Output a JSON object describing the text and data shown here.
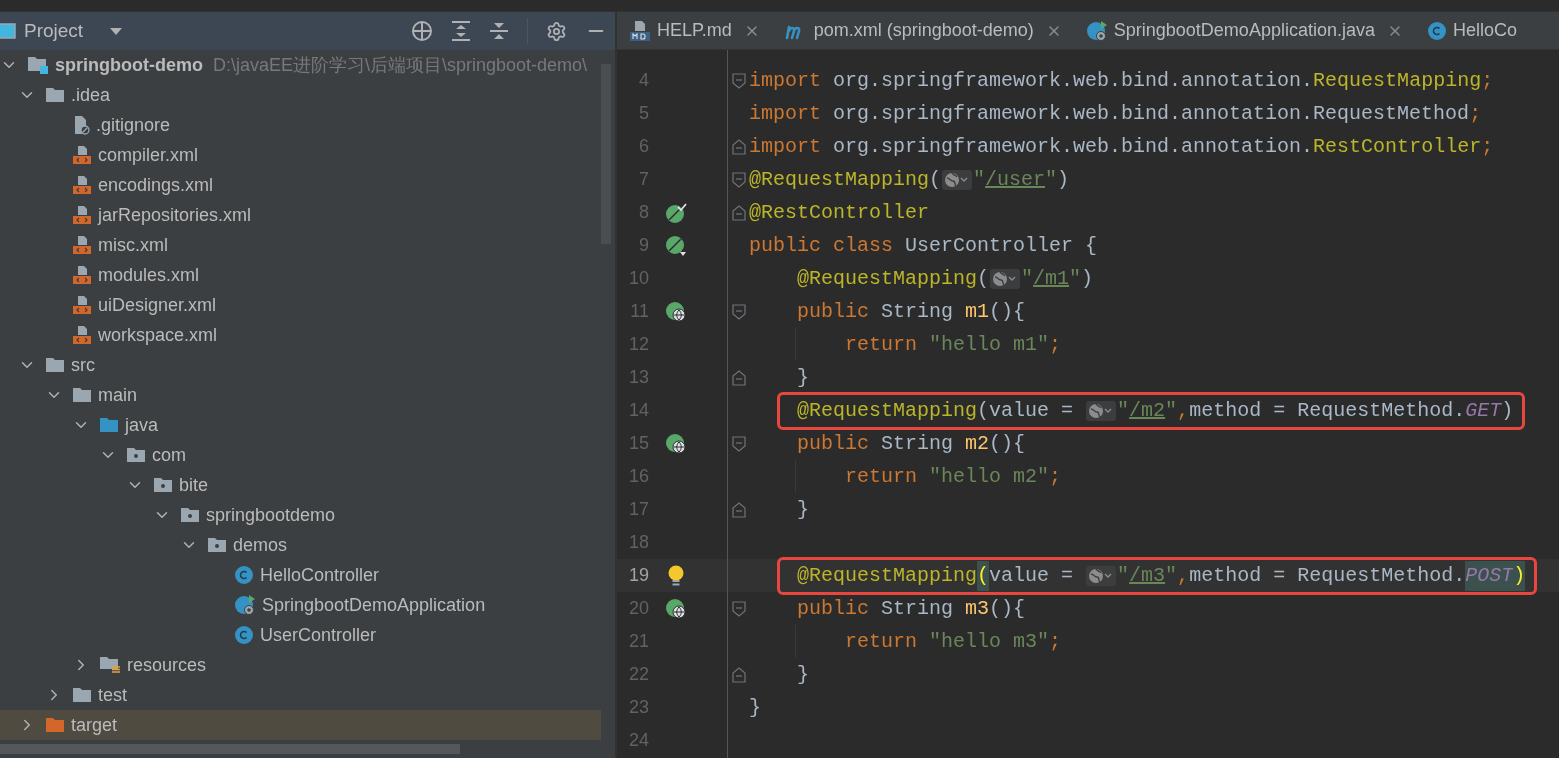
{
  "project_panel": {
    "title": "Project",
    "tree": [
      {
        "kind": "module",
        "name": "springboot-demo",
        "path": "D:\\javaEE进阶学习\\后端项目\\springboot-demo\\",
        "expanded": true,
        "children": [
          {
            "kind": "folder",
            "name": ".idea",
            "expanded": true,
            "children": [
              {
                "kind": "ignore-file",
                "name": ".gitignore"
              },
              {
                "kind": "xml-file",
                "name": "compiler.xml"
              },
              {
                "kind": "xml-file",
                "name": "encodings.xml"
              },
              {
                "kind": "xml-file",
                "name": "jarRepositories.xml"
              },
              {
                "kind": "xml-file",
                "name": "misc.xml"
              },
              {
                "kind": "xml-file",
                "name": "modules.xml"
              },
              {
                "kind": "xml-file",
                "name": "uiDesigner.xml"
              },
              {
                "kind": "xml-file",
                "name": "workspace.xml"
              }
            ]
          },
          {
            "kind": "folder",
            "name": "src",
            "expanded": true,
            "children": [
              {
                "kind": "folder",
                "name": "main",
                "expanded": true,
                "children": [
                  {
                    "kind": "source-folder",
                    "name": "java",
                    "expanded": true,
                    "children": [
                      {
                        "kind": "package",
                        "name": "com",
                        "expanded": true,
                        "children": [
                          {
                            "kind": "package",
                            "name": "bite",
                            "expanded": true,
                            "children": [
                              {
                                "kind": "package",
                                "name": "springbootdemo",
                                "expanded": true,
                                "children": [
                                  {
                                    "kind": "package",
                                    "name": "demos",
                                    "expanded": true,
                                    "children": [
                                      {
                                        "kind": "class",
                                        "name": "HelloController"
                                      },
                                      {
                                        "kind": "app-class",
                                        "name": "SpringbootDemoApplication"
                                      },
                                      {
                                        "kind": "class",
                                        "name": "UserController"
                                      }
                                    ]
                                  }
                                ]
                              }
                            ]
                          }
                        ]
                      }
                    ]
                  },
                  {
                    "kind": "resources-folder",
                    "name": "resources",
                    "expanded": false
                  }
                ]
              },
              {
                "kind": "folder",
                "name": "test",
                "expanded": false
              }
            ]
          },
          {
            "kind": "excluded-folder",
            "name": "target",
            "expanded": false
          }
        ]
      }
    ]
  },
  "editor": {
    "tabs": [
      {
        "kind": "md",
        "label": "HELP.md",
        "selected": false,
        "closable": true
      },
      {
        "kind": "maven",
        "label": "pom.xml (springboot-demo)",
        "selected": false,
        "closable": true
      },
      {
        "kind": "spring-app",
        "label": "SpringbootDemoApplication.java",
        "selected": false,
        "closable": true
      },
      {
        "kind": "class",
        "label": "HelloCo",
        "selected": false,
        "closable": false
      }
    ],
    "lines": [
      {
        "number": "4",
        "fold": {
          "kind": "start"
        },
        "current": false,
        "highlighted": false,
        "tokens": [
          {
            "kind": "keyword",
            "text": "import"
          },
          {
            "kind": "plain",
            "text": " org.springframework.web.bind.annotation."
          },
          {
            "kind": "annotation",
            "text": "RequestMapping"
          },
          {
            "kind": "keyword",
            "text": ";"
          }
        ]
      },
      {
        "number": "5",
        "current": false,
        "highlighted": false,
        "tokens": [
          {
            "kind": "keyword",
            "text": "import"
          },
          {
            "kind": "plain",
            "text": " org.springframework.web.bind.annotation.RequestMethod"
          },
          {
            "kind": "keyword",
            "text": ";"
          }
        ]
      },
      {
        "number": "6",
        "fold": {
          "kind": "end"
        },
        "current": false,
        "highlighted": false,
        "tokens": [
          {
            "kind": "keyword",
            "text": "import"
          },
          {
            "kind": "plain",
            "text": " org.springframework.web.bind.annotation."
          },
          {
            "kind": "annotation",
            "text": "RestController"
          },
          {
            "kind": "keyword",
            "text": ";"
          }
        ]
      },
      {
        "number": "7",
        "fold": {
          "kind": "start"
        },
        "current": false,
        "highlighted": false,
        "tokens": [
          {
            "kind": "annotation",
            "text": "@RequestMapping"
          },
          {
            "kind": "plain",
            "text": "("
          },
          {
            "kind": "inlay"
          },
          {
            "kind": "string",
            "text": "\""
          },
          {
            "kind": "link",
            "text": "/user"
          },
          {
            "kind": "string",
            "text": "\""
          },
          {
            "kind": "plain",
            "text": ")"
          }
        ]
      },
      {
        "number": "8",
        "gutter": {
          "kind": "bean-check"
        },
        "fold": {
          "kind": "end"
        },
        "current": false,
        "highlighted": false,
        "tokens": [
          {
            "kind": "annotation",
            "text": "@RestController"
          }
        ]
      },
      {
        "number": "9",
        "gutter": {
          "kind": "bean-down"
        },
        "current": false,
        "highlighted": false,
        "tokens": [
          {
            "kind": "keyword",
            "text": "public class "
          },
          {
            "kind": "plain",
            "text": "UserController {"
          }
        ]
      },
      {
        "number": "10",
        "indent": {
          "kind": "single"
        },
        "current": false,
        "highlighted": false,
        "tokens": [
          {
            "kind": "annotation",
            "text": "@RequestMapping"
          },
          {
            "kind": "plain",
            "text": "("
          },
          {
            "kind": "inlay"
          },
          {
            "kind": "string",
            "text": "\""
          },
          {
            "kind": "link",
            "text": "/m1"
          },
          {
            "kind": "string",
            "text": "\""
          },
          {
            "kind": "plain",
            "text": ")"
          }
        ]
      },
      {
        "number": "11",
        "indent": {
          "kind": "single"
        },
        "gutter": {
          "kind": "web"
        },
        "fold": {
          "kind": "start"
        },
        "current": false,
        "highlighted": false,
        "tokens": [
          {
            "kind": "keyword",
            "text": "public "
          },
          {
            "kind": "plain",
            "text": "String "
          },
          {
            "kind": "method",
            "text": "m1"
          },
          {
            "kind": "plain",
            "text": "(){"
          }
        ]
      },
      {
        "number": "12",
        "indent": {
          "kind": "double"
        },
        "current": false,
        "highlighted": false,
        "tokens": [
          {
            "kind": "keyword",
            "text": "return "
          },
          {
            "kind": "string",
            "text": "\"hello m1\""
          },
          {
            "kind": "keyword",
            "text": ";"
          }
        ]
      },
      {
        "number": "13",
        "indent": {
          "kind": "single"
        },
        "fold": {
          "kind": "end"
        },
        "current": false,
        "highlighted": false,
        "tokens": [
          {
            "kind": "plain",
            "text": "}"
          }
        ]
      },
      {
        "number": "14",
        "indent": {
          "kind": "single"
        },
        "current": false,
        "highlighted": true,
        "tokens": [
          {
            "kind": "annotation",
            "text": "@RequestMapping"
          },
          {
            "kind": "plain",
            "text": "(value = "
          },
          {
            "kind": "inlay"
          },
          {
            "kind": "string",
            "text": "\""
          },
          {
            "kind": "link",
            "text": "/m2"
          },
          {
            "kind": "string",
            "text": "\""
          },
          {
            "kind": "keyword",
            "text": ","
          },
          {
            "kind": "plain",
            "text": "method = RequestMethod."
          },
          {
            "kind": "constant",
            "text": "GET"
          },
          {
            "kind": "plain",
            "text": ")"
          }
        ]
      },
      {
        "number": "15",
        "indent": {
          "kind": "single"
        },
        "gutter": {
          "kind": "web"
        },
        "fold": {
          "kind": "start"
        },
        "current": false,
        "highlighted": false,
        "tokens": [
          {
            "kind": "keyword",
            "text": "public "
          },
          {
            "kind": "plain",
            "text": "String "
          },
          {
            "kind": "method",
            "text": "m2"
          },
          {
            "kind": "plain",
            "text": "(){"
          }
        ]
      },
      {
        "number": "16",
        "indent": {
          "kind": "double"
        },
        "current": false,
        "highlighted": false,
        "tokens": [
          {
            "kind": "keyword",
            "text": "return "
          },
          {
            "kind": "string",
            "text": "\"hello m2\""
          },
          {
            "kind": "keyword",
            "text": ";"
          }
        ]
      },
      {
        "number": "17",
        "indent": {
          "kind": "single"
        },
        "fold": {
          "kind": "end"
        },
        "current": false,
        "highlighted": false,
        "tokens": [
          {
            "kind": "plain",
            "text": "}"
          }
        ]
      },
      {
        "number": "18",
        "current": false,
        "highlighted": false
      },
      {
        "number": "19",
        "indent": {
          "kind": "single"
        },
        "gutter": {
          "kind": "bulb"
        },
        "current": true,
        "highlighted": true,
        "tokens": [
          {
            "kind": "annotation",
            "text": "@RequestMapping"
          },
          {
            "kind": "brace-match",
            "text": "("
          },
          {
            "kind": "plain",
            "text": "value = "
          },
          {
            "kind": "inlay"
          },
          {
            "kind": "string",
            "text": "\""
          },
          {
            "kind": "link",
            "text": "/m3"
          },
          {
            "kind": "string",
            "text": "\""
          },
          {
            "kind": "keyword",
            "text": ","
          },
          {
            "kind": "plain",
            "text": "method = RequestMethod."
          },
          {
            "kind": "constant-match",
            "text": "POST"
          },
          {
            "kind": "brace-match",
            "text": ")"
          }
        ]
      },
      {
        "number": "20",
        "indent": {
          "kind": "single"
        },
        "gutter": {
          "kind": "web"
        },
        "fold": {
          "kind": "start"
        },
        "current": false,
        "highlighted": false,
        "tokens": [
          {
            "kind": "keyword",
            "text": "public "
          },
          {
            "kind": "plain",
            "text": "String "
          },
          {
            "kind": "method",
            "text": "m3"
          },
          {
            "kind": "plain",
            "text": "(){"
          }
        ]
      },
      {
        "number": "21",
        "indent": {
          "kind": "double"
        },
        "current": false,
        "highlighted": false,
        "tokens": [
          {
            "kind": "keyword",
            "text": "return "
          },
          {
            "kind": "string",
            "text": "\"hello m3\""
          },
          {
            "kind": "keyword",
            "text": ";"
          }
        ]
      },
      {
        "number": "22",
        "indent": {
          "kind": "single"
        },
        "fold": {
          "kind": "end"
        },
        "current": false,
        "highlighted": false,
        "tokens": [
          {
            "kind": "plain",
            "text": "}"
          }
        ]
      },
      {
        "number": "23",
        "current": false,
        "highlighted": false,
        "tokens": [
          {
            "kind": "plain",
            "text": "}"
          }
        ]
      },
      {
        "number": "24",
        "current": false,
        "highlighted": false
      }
    ]
  }
}
